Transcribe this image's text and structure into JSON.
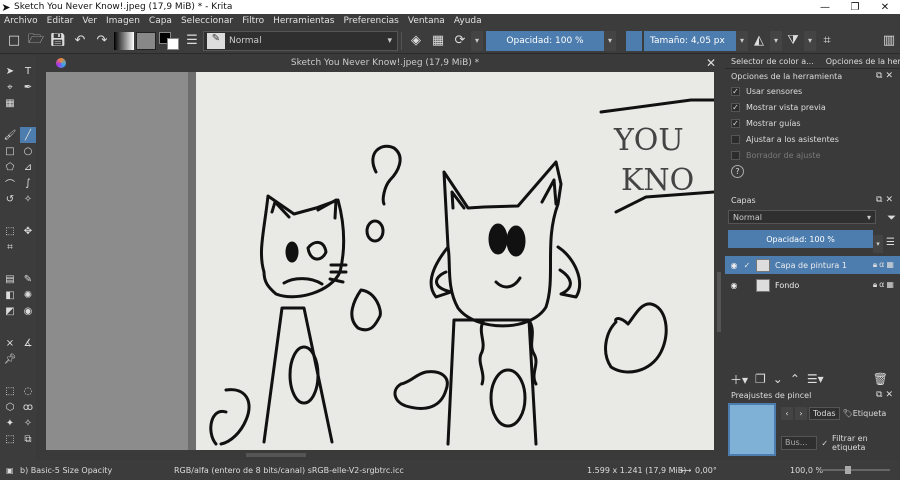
{
  "window": {
    "title": "Sketch You Never Know!.jpeg (17,9 MiB) * - Krita",
    "controls": [
      "—",
      "❐",
      "✕"
    ]
  },
  "menu": [
    "Archivo",
    "Editar",
    "Ver",
    "Imagen",
    "Capa",
    "Seleccionar",
    "Filtro",
    "Herramientas",
    "Preferencias",
    "Ventana",
    "Ayuda"
  ],
  "toolbar": {
    "blend_mode": "Normal",
    "opacity": "Opacidad: 100 %",
    "size": "Tamaño: 4,05 px"
  },
  "document": {
    "tab_title": "Sketch You Never Know!.jpeg (17,9 MiB) *",
    "sketch_text_line1": "YOU",
    "sketch_text_line2": "KNO"
  },
  "dock": {
    "tabs": [
      "Selector de color a...",
      "Opciones de la her..."
    ],
    "tool_options_title": "Opciones de la herramienta",
    "options": [
      {
        "label": "Usar sensores",
        "checked": true,
        "enabled": true
      },
      {
        "label": "Mostrar vista previa",
        "checked": true,
        "enabled": true
      },
      {
        "label": "Mostrar guías",
        "checked": true,
        "enabled": true
      },
      {
        "label": "Ajustar a los asistentes",
        "checked": false,
        "enabled": true
      },
      {
        "label": "Borrador de ajuste",
        "checked": false,
        "enabled": false
      }
    ],
    "help_label": "?"
  },
  "layers": {
    "title": "Capas",
    "blend_mode": "Normal",
    "opacity": "Opacidad: 100 %",
    "items": [
      {
        "name": "Capa de pintura 1",
        "selected": true
      },
      {
        "name": "Fondo",
        "selected": false
      }
    ]
  },
  "presets": {
    "title": "Preajustes de pincel",
    "tag_filter": "Todas",
    "tag_label": "Etiqueta",
    "search_placeholder": "Bus...",
    "filter_label": "Filtrar en etiqueta"
  },
  "status": {
    "preset_name": "b) Basic-5 Size Opacity",
    "color_space": "RGB/alfa (entero de 8 bits/canal)  sRGB-elle-V2-srgbtrc.icc",
    "dimensions": "1.599 x 1.241 (17,9 MiB)",
    "rotation": "0,00°",
    "zoom": "100,0 %"
  }
}
